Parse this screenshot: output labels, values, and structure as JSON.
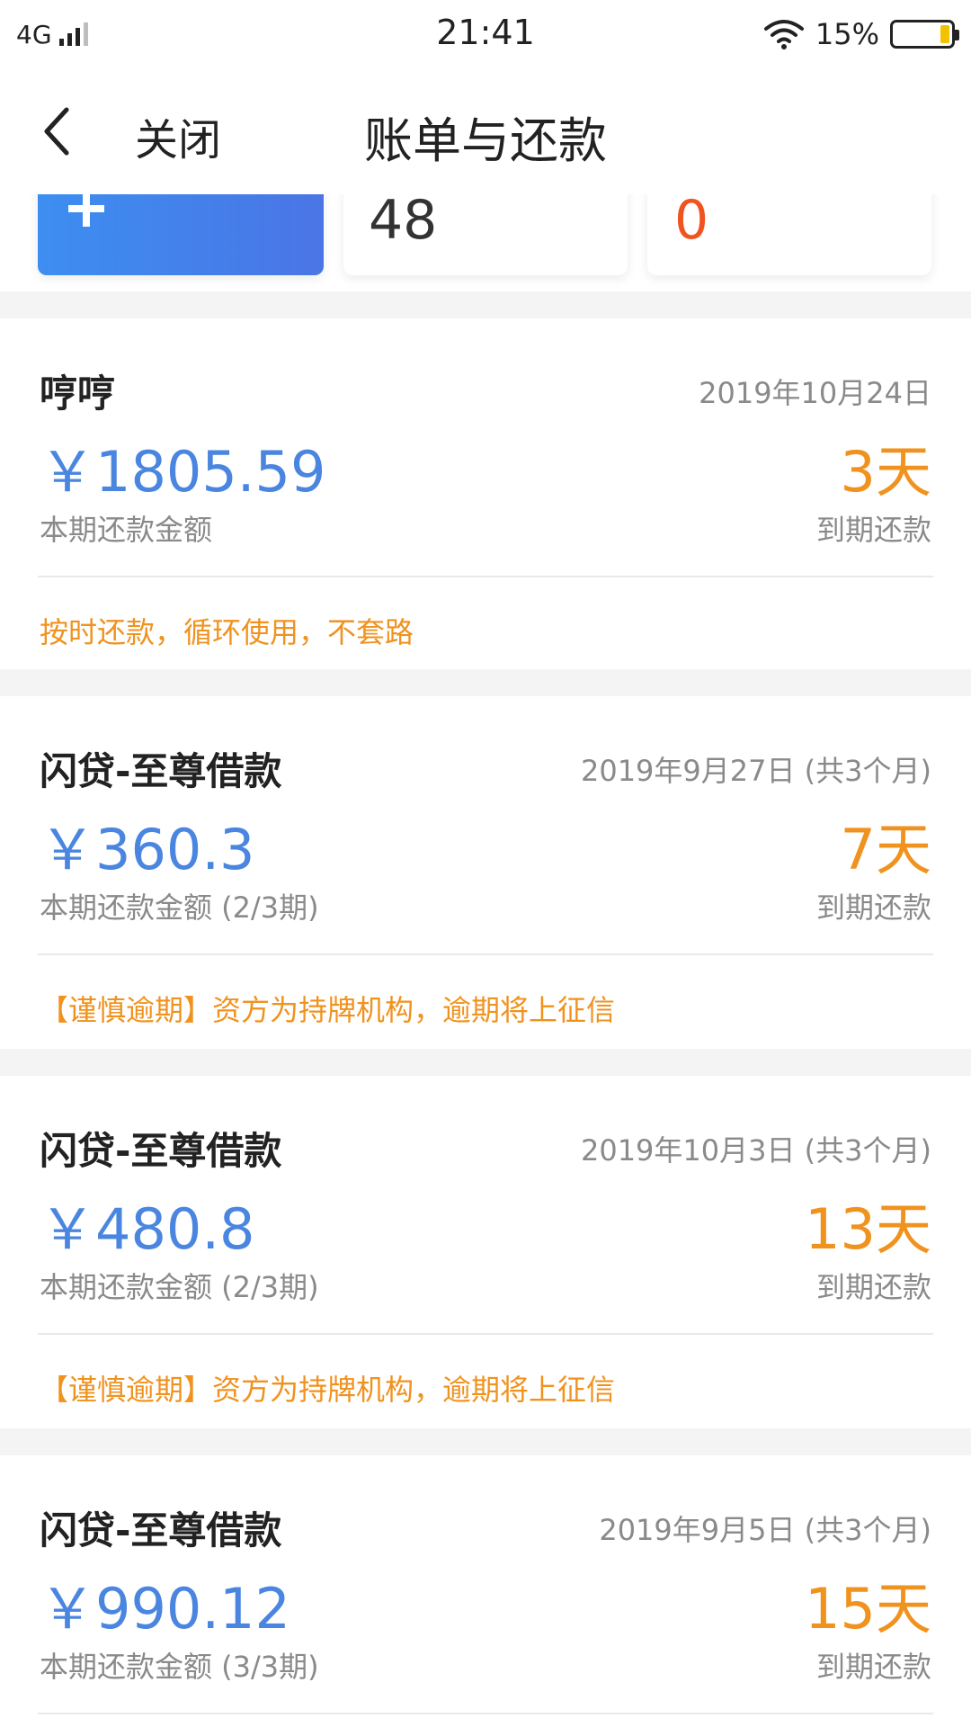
{
  "status_bar": {
    "network": "4G",
    "time": "21:41",
    "battery_percent_label": "15%",
    "battery_level": 0.15,
    "icons": [
      "signal-icon",
      "wifi-icon",
      "battery-icon"
    ]
  },
  "nav": {
    "back_icon": "chevron-left-icon",
    "close_label": "关闭",
    "title": "账单与还款"
  },
  "summary": {
    "cards": [
      {
        "icon": "plus-icon",
        "color": "#4a80ea"
      },
      {
        "value": "48"
      },
      {
        "value": "0",
        "color": "#f0531f"
      }
    ]
  },
  "colors": {
    "amount": "#4a86e0",
    "days": "#f0921e",
    "notice": "#f0921e",
    "muted": "#8a8a8a"
  },
  "bills": [
    {
      "name": "哼哼",
      "date": "2019年10月24日",
      "amount": "￥1805.59",
      "days": "3天",
      "amount_label": "本期还款金额",
      "due_label": "到期还款",
      "notice": "按时还款，循环使用，不套路"
    },
    {
      "name": "闪贷-至尊借款",
      "date": "2019年9月27日 (共3个月)",
      "amount": "￥360.3",
      "days": "7天",
      "amount_label": "本期还款金额 (2/3期)",
      "due_label": "到期还款",
      "notice": "【谨慎逾期】资方为持牌机构，逾期将上征信"
    },
    {
      "name": "闪贷-至尊借款",
      "date": "2019年10月3日 (共3个月)",
      "amount": "￥480.8",
      "days": "13天",
      "amount_label": "本期还款金额 (2/3期)",
      "due_label": "到期还款",
      "notice": "【谨慎逾期】资方为持牌机构，逾期将上征信"
    },
    {
      "name": "闪贷-至尊借款",
      "date": "2019年9月5日 (共3个月)",
      "amount": "￥990.12",
      "days": "15天",
      "amount_label": "本期还款金额 (3/3期)",
      "due_label": "到期还款"
    }
  ]
}
